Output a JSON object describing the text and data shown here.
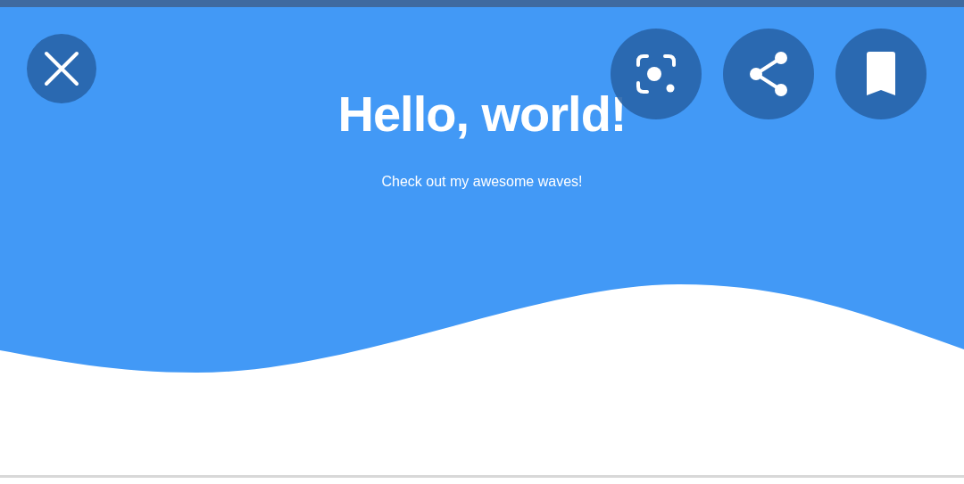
{
  "title": "Hello, world!",
  "subtitle": "Check out my awesome waves!",
  "buttons": [
    {
      "kind": "close"
    },
    {
      "kind": "lens"
    },
    {
      "kind": "share"
    },
    {
      "kind": "bookmark"
    }
  ]
}
